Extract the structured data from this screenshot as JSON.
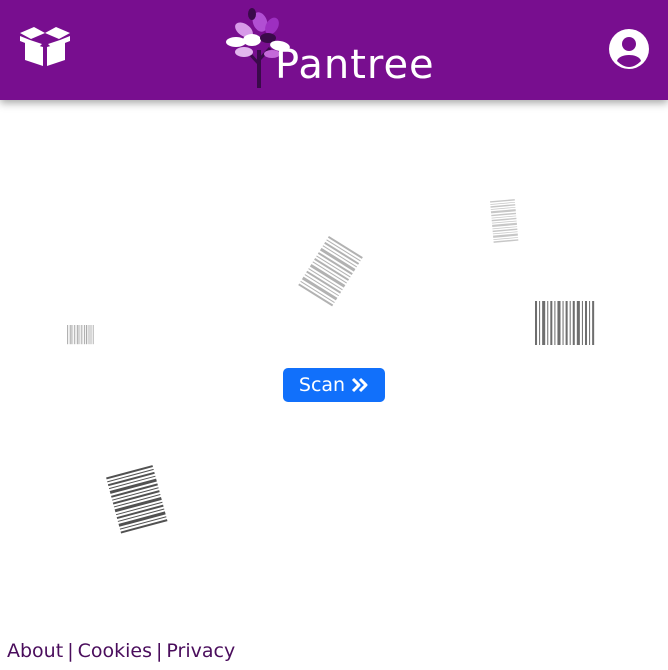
{
  "header": {
    "brand_name": "Pantree",
    "left_icon": "open-box-icon",
    "right_icon": "user-circle-icon",
    "background_color": "#780e8f"
  },
  "main": {
    "scan_label": "Scan",
    "scan_icon": "double-chevron-right-icon",
    "scan_color": "#1170fb"
  },
  "footer": {
    "links": [
      "About",
      "Cookies",
      "Privacy"
    ],
    "separator": "|"
  }
}
